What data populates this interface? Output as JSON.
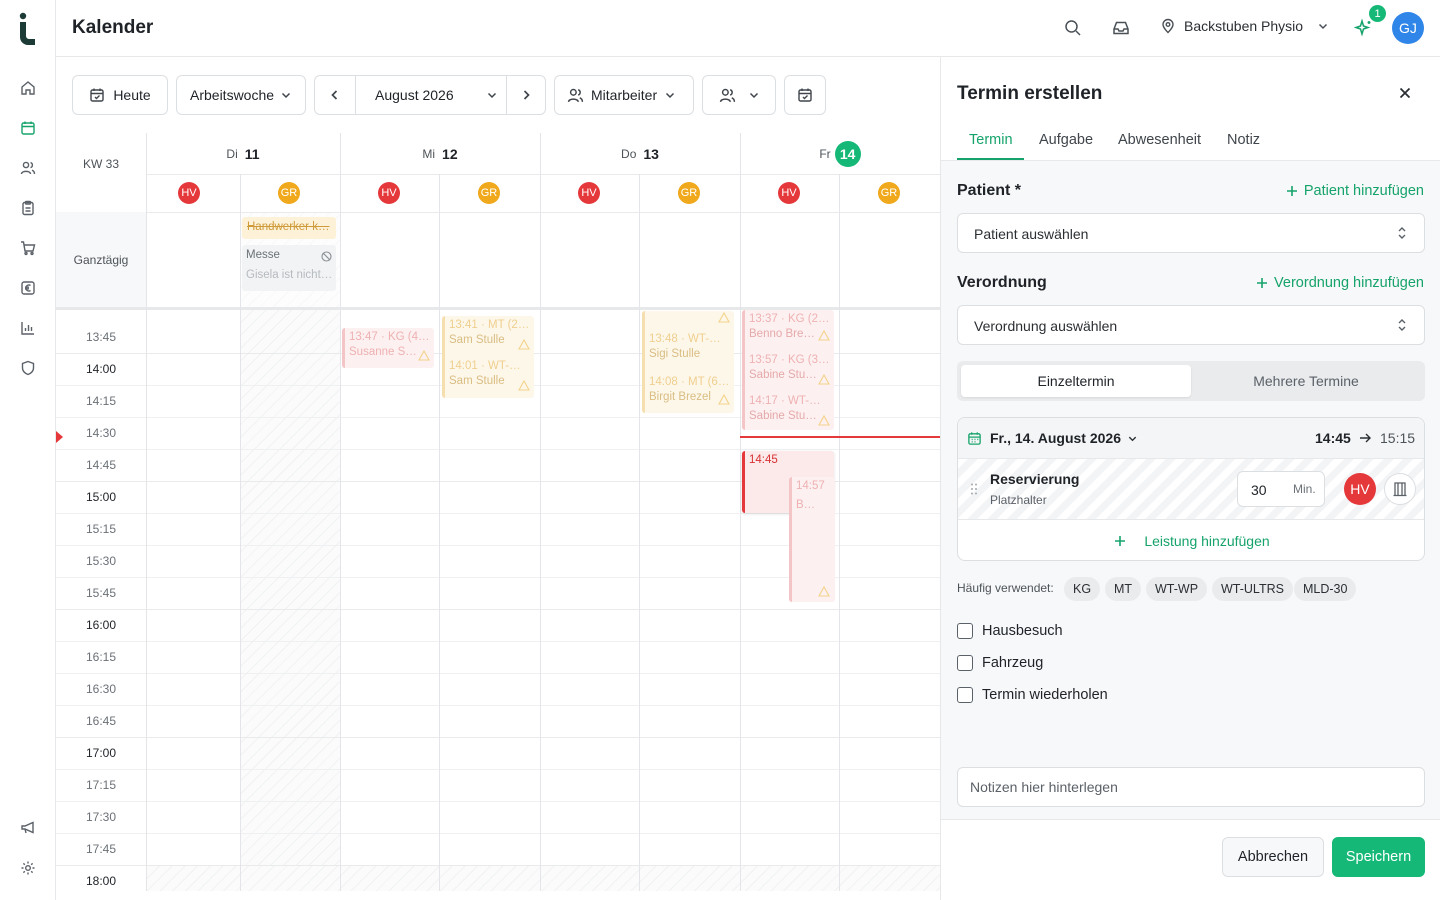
{
  "header": {
    "title": "Kalender",
    "location": "Backstuben Physio",
    "notification_count": "1",
    "user_initials": "GJ"
  },
  "toolbar": {
    "today": "Heute",
    "view": "Arbeitswoche",
    "month": "August 2026",
    "staff": "Mitarbeiter"
  },
  "calendar": {
    "week": "KW 33",
    "allday_label": "Ganztägig",
    "days": [
      {
        "name": "Di",
        "num": "11"
      },
      {
        "name": "Mi",
        "num": "12"
      },
      {
        "name": "Do",
        "num": "13"
      },
      {
        "name": "Fr",
        "num": "14"
      }
    ],
    "chips": [
      "HV",
      "GR"
    ],
    "allday_events": [
      {
        "title": "Handwerker k…"
      },
      {
        "title": "Messe",
        "subtitle": "Gisela ist nicht…"
      }
    ],
    "times": [
      "13:45",
      "14:00",
      "14:15",
      "14:30",
      "14:45",
      "15:00",
      "15:15",
      "15:30",
      "15:45",
      "16:00",
      "16:15",
      "16:30",
      "16:45",
      "17:00",
      "17:15",
      "17:30",
      "17:45",
      "18:00"
    ],
    "events": [
      {
        "time": "13:47 · KG (4…",
        "person": "Susanne S…"
      },
      {
        "time": "13:41 · MT (2…",
        "person": "Sam Stulle"
      },
      {
        "time": "14:01 · WT-…",
        "person": "Sam Stulle"
      },
      {
        "time": "13:48 · WT-…",
        "person": "Sigi Stulle"
      },
      {
        "time": "14:08 · MT (6…",
        "person": "Birgit Brezel"
      },
      {
        "time": "13:37 · KG (2…",
        "person": "Benno Bre…"
      },
      {
        "time": "13:57 · KG (3…",
        "person": "Sabine Stu…"
      },
      {
        "time": "14:17 · WT-…",
        "person": "Sabine Stu…"
      },
      {
        "time": "14:45",
        "person": ""
      },
      {
        "time": "14:57",
        "person": "B…"
      }
    ]
  },
  "panel": {
    "title": "Termin erstellen",
    "tabs": [
      "Termin",
      "Aufgabe",
      "Abwesenheit",
      "Notiz"
    ],
    "patient_label": "Patient *",
    "add_patient": "Patient hinzufügen",
    "patient_placeholder": "Patient auswählen",
    "prescription_label": "Verordnung",
    "add_prescription": "Verordnung hinzufügen",
    "prescription_placeholder": "Verordnung auswählen",
    "segments": [
      "Einzeltermin",
      "Mehrere Termine"
    ],
    "date": "Fr., 14. August 2026",
    "start_time": "14:45",
    "end_time": "15:15",
    "service_title": "Reservierung",
    "service_subtitle": "Platzhalter",
    "duration": "30",
    "duration_unit": "Min.",
    "therapist": "HV",
    "add_service": "Leistung hinzufügen",
    "frequent_label": "Häufig verwendet:",
    "frequent": [
      "KG",
      "MT",
      "WT-WP",
      "WT-ULTRS",
      "MLD-30"
    ],
    "checkboxes": [
      "Hausbesuch",
      "Fahrzeug",
      "Termin wiederholen"
    ],
    "notes_placeholder": "Notizen hier hinterlegen",
    "cancel": "Abbrechen",
    "save": "Speichern"
  },
  "colors": {
    "accent": "#16b877",
    "hv": "#e5383b",
    "gr": "#f0a81c",
    "avatar": "#2f86e8"
  }
}
